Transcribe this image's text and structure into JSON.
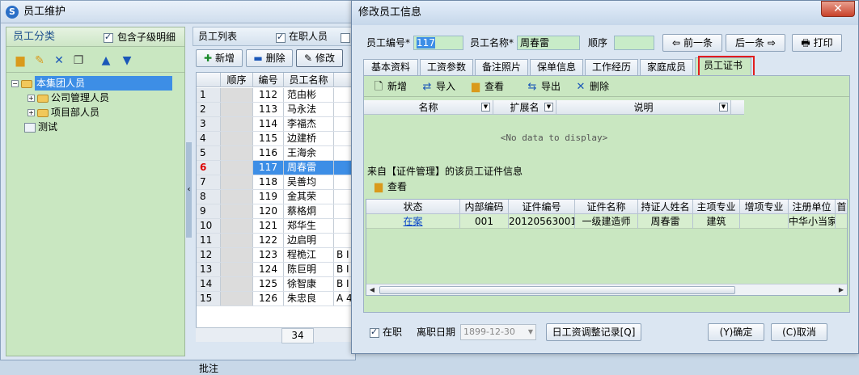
{
  "main_window": {
    "title": "员工维护",
    "left": {
      "header": "员工分类",
      "include_children_label": "包含子级明细",
      "include_children_checked": true,
      "tree": [
        {
          "label": "本集团人员",
          "level": 0,
          "selected": true
        },
        {
          "label": "公司管理人员",
          "level": 1
        },
        {
          "label": "项目部人员",
          "level": 1
        },
        {
          "label": "测试",
          "level": 0
        }
      ]
    },
    "middle": {
      "header": "员工列表",
      "in_service_label": "在职人员",
      "in_service_checked": true,
      "toolbar": {
        "add": "新增",
        "delete": "删除",
        "modify": "修改"
      },
      "columns": {
        "seq": "顺序",
        "code": "编号",
        "name": "员工名称"
      },
      "rows": [
        {
          "n": "1",
          "code": "112",
          "name": "范由彬",
          "extra": ""
        },
        {
          "n": "2",
          "code": "113",
          "name": "马永法",
          "extra": ""
        },
        {
          "n": "3",
          "code": "114",
          "name": "李福杰",
          "extra": ""
        },
        {
          "n": "4",
          "code": "115",
          "name": "边建桥",
          "extra": ""
        },
        {
          "n": "5",
          "code": "116",
          "name": "王海余",
          "extra": ""
        },
        {
          "n": "6",
          "code": "117",
          "name": "周春雷",
          "extra": "",
          "selected": true
        },
        {
          "n": "7",
          "code": "118",
          "name": "吴善均",
          "extra": ""
        },
        {
          "n": "8",
          "code": "119",
          "name": "金其荣",
          "extra": ""
        },
        {
          "n": "9",
          "code": "120",
          "name": "蔡格炯",
          "extra": ""
        },
        {
          "n": "10",
          "code": "121",
          "name": "郑华生",
          "extra": ""
        },
        {
          "n": "11",
          "code": "122",
          "name": "边启明",
          "extra": ""
        },
        {
          "n": "12",
          "code": "123",
          "name": "程桅江",
          "extra": "B I"
        },
        {
          "n": "13",
          "code": "124",
          "name": "陈巨明",
          "extra": "B I"
        },
        {
          "n": "14",
          "code": "125",
          "name": "徐智康",
          "extra": "B I"
        },
        {
          "n": "15",
          "code": "126",
          "name": "朱忠良",
          "extra": "A 4"
        }
      ],
      "footer_count": "34",
      "remark_label": "批注"
    }
  },
  "dialog": {
    "title": "修改员工信息",
    "close_label": "✕",
    "fields": {
      "code_label": "员工编号*",
      "code_value": "117",
      "name_label": "员工名称*",
      "name_value": "周春雷",
      "order_label": "顺序",
      "order_value": ""
    },
    "nav": {
      "prev": "前一条",
      "next": "后一条",
      "print": "打印"
    },
    "tabs": [
      "基本资料",
      "工资参数",
      "备注照片",
      "保单信息",
      "工作经历",
      "家庭成员",
      "员工证书"
    ],
    "active_tab": 6,
    "cert_toolbar": {
      "add": "新增",
      "import": "导入",
      "view": "查看",
      "export": "导出",
      "delete": "删除"
    },
    "cert_columns": [
      "名称",
      "扩展名",
      "说明"
    ],
    "no_data": "<No data to display>",
    "source_label": "来自【证件管理】的该员工证件信息",
    "view_label": "查看",
    "reg_columns": [
      "状态",
      "内部编码",
      "证件编号",
      "证件名称",
      "持证人姓名",
      "主项专业",
      "增项专业",
      "注册单位",
      "首"
    ],
    "reg_rows": [
      [
        "在案",
        "001",
        "20120563001",
        "一级建造师",
        "周春雷",
        "建筑",
        "",
        "中华小当家",
        ""
      ]
    ],
    "bottom": {
      "in_service_label": "在职",
      "in_service_checked": true,
      "leave_date_label": "离职日期",
      "leave_date_value": "1899-12-30",
      "salary_log": "日工资调整记录[Q]",
      "ok": "(Y)确定",
      "cancel": "(C)取消"
    }
  }
}
